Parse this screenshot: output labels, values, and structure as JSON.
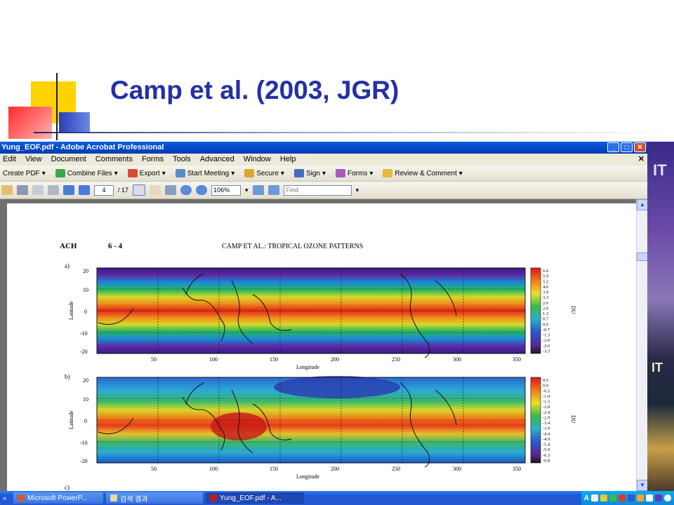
{
  "slide": {
    "title": "Camp et al. (2003, JGR)"
  },
  "window": {
    "title": "Yung_EOF.pdf - Adobe Acrobat Professional",
    "menu": [
      "Edit",
      "View",
      "Document",
      "Comments",
      "Forms",
      "Tools",
      "Advanced",
      "Window",
      "Help"
    ],
    "toolbar": [
      "Create PDF",
      "Combine Files",
      "Export",
      "Start Meeting",
      "Secure",
      "Sign",
      "Forms",
      "Review & Comment"
    ],
    "page_current": "4",
    "page_total": "/ 17",
    "zoom": "106%",
    "find_placeholder": "Find"
  },
  "document": {
    "header_left": "ACH",
    "header_page": "6 - 4",
    "header_title": "CAMP ET AL.: TROPICAL OZONE PATTERNS",
    "panel_a_label": "a)",
    "panel_b_label": "b)",
    "panel_c_label": "c)",
    "y_axis_label": "Latitude",
    "x_axis_label": "Longitude",
    "colorbar_unit": "DU",
    "lat_ticks": [
      "20",
      "10",
      "0",
      "-10",
      "-20"
    ],
    "lon_ticks": [
      "50",
      "100",
      "150",
      "200",
      "250",
      "300",
      "350"
    ],
    "colorbar_a": [
      "6.6",
      "5.9",
      "5.2",
      "4.6",
      "3.9",
      "3.3",
      "2.6",
      "2.0",
      "1.3",
      "0.7",
      "0.0",
      "-0.7",
      "-1.3",
      "-2.0",
      "-2.6",
      "-3.3"
    ],
    "colorbar_b": [
      "0.5",
      "0.0",
      "-0.5",
      "-1.0",
      "-1.5",
      "-2.0",
      "-2.4",
      "-2.9",
      "-3.4",
      "-3.9",
      "-4.4",
      "-4.9",
      "-5.4",
      "-5.9",
      "-6.3",
      "-6.8"
    ]
  },
  "taskbar": {
    "items": [
      "Microsoft PowerP...",
      "검색 결과",
      "Yung_EOF.pdf - A..."
    ]
  }
}
